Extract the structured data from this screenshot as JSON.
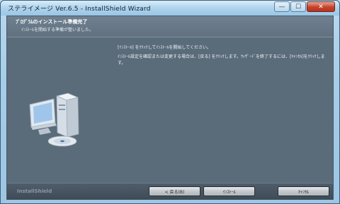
{
  "window": {
    "title": "ステライメージ Ver.6.5 - InstallShield Wizard",
    "minimize_glyph": "—",
    "maximize_glyph": "☐",
    "close_glyph": "✕"
  },
  "header": {
    "title": "ﾌﾟﾛｸﾞﾗﾑのインストール準備完了",
    "subtitle": "ｲﾝｽﾄｰﾙを開始する準備が整いました。"
  },
  "body": {
    "line1": "[ｲﾝｽﾄｰﾙ] をｸﾘｯｸしてｲﾝｽﾄｰﾙを開始してください。",
    "line2": "ｲﾝｽﾄｰﾙ設定を確認または変更する場合は、[戻る] をｸﾘｯｸします。ｳｨｻﾞｰﾄﾞを終了するには、[ｷｬﾝｾﾙ]をｸﾘｯｸします。"
  },
  "footer": {
    "brand": "InstallShield",
    "back_label": "< 戻る(B)",
    "install_label": "ｲﾝｽﾄｰﾙ",
    "cancel_label": "ｷｬﾝｾﾙ"
  },
  "icons": {
    "computer": "computer-icon"
  }
}
